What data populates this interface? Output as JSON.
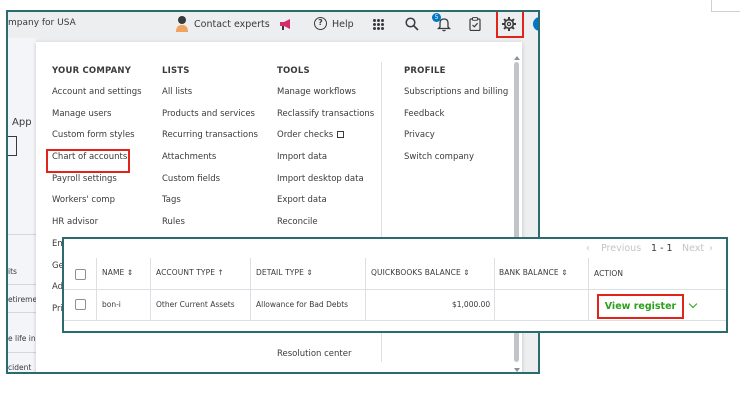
{
  "topbar": {
    "company": "mpany for USA",
    "contact_experts": "Contact experts",
    "help": "Help",
    "bell_count": "5"
  },
  "left_page": {
    "app_tab": "App",
    "fragments": [
      "its",
      "etireme",
      "e life ina",
      "cident"
    ]
  },
  "menu": {
    "your_company": {
      "heading": "YOUR COMPANY",
      "items": [
        "Account and settings",
        "Manage users",
        "Custom form styles",
        "Chart of accounts",
        "Payroll settings",
        "Workers' comp",
        "HR advisor",
        "Em",
        "Ge",
        "Ad",
        "Pri"
      ]
    },
    "lists": {
      "heading": "LISTS",
      "items": [
        "All lists",
        "Products and services",
        "Recurring transactions",
        "Attachments",
        "Custom fields",
        "Tags",
        "Rules"
      ]
    },
    "tools": {
      "heading": "TOOLS",
      "items": [
        "Manage workflows",
        "Reclassify transactions",
        "Order checks",
        "Import data",
        "Import desktop data",
        "Export data",
        "Reconcile"
      ],
      "resolution_center": "Resolution center"
    },
    "profile": {
      "heading": "PROFILE",
      "items": [
        "Subscriptions and billing",
        "Feedback",
        "Privacy",
        "Switch company"
      ]
    }
  },
  "accounts_table": {
    "pager": {
      "previous": "Previous",
      "range": "1 - 1",
      "next": "Next"
    },
    "columns": [
      "NAME",
      "ACCOUNT TYPE",
      "DETAIL TYPE",
      "QUICKBOOKS BALANCE",
      "BANK BALANCE",
      "ACTION"
    ],
    "rows": [
      {
        "name": "bon-i",
        "account_type": "Other Current Assets",
        "detail_type": "Allowance for Bad Debts",
        "quickbooks_balance": "$1,000.00",
        "bank_balance": "",
        "action": "View register"
      }
    ]
  },
  "colors": {
    "frame_border": "#2b6b6e",
    "highlight_red": "#e2231a",
    "action_green": "#2ca01c",
    "text": "#393a3d"
  }
}
